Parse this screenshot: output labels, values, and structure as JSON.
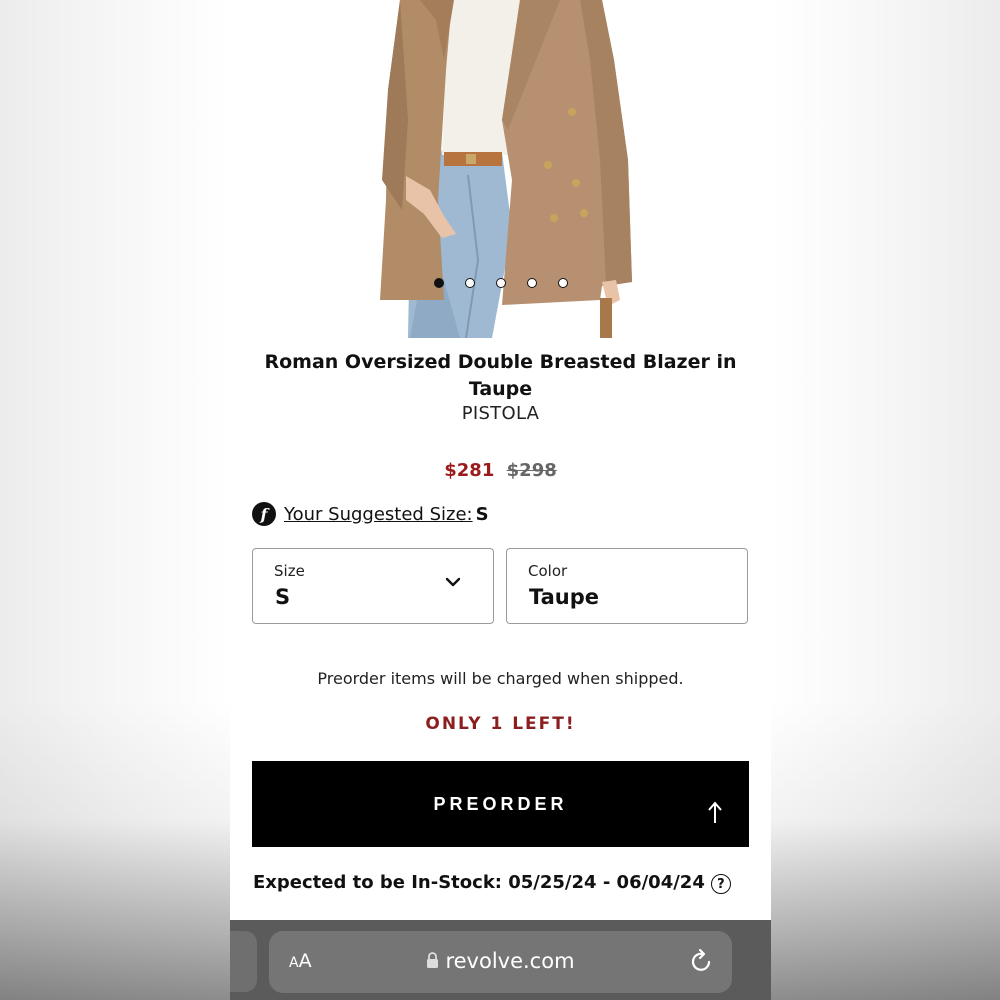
{
  "product": {
    "title": "Roman Oversized Double Breasted Blazer in Taupe",
    "brand": "PISTOLA",
    "sale_price": "$281",
    "original_price": "$298",
    "image_count": 5,
    "active_image_index": 0
  },
  "fit": {
    "link_text": "Your Suggested Size:",
    "suggested_size": "S",
    "logo_glyph": "f"
  },
  "size_select": {
    "label": "Size",
    "value": "S",
    "icon": "chevron-down-icon"
  },
  "color_select": {
    "label": "Color",
    "value": "Taupe"
  },
  "notes": {
    "preorder_note": "Preorder items will be charged when shipped.",
    "stock_left": "ONLY 1 LEFT!"
  },
  "cta": {
    "label": "PREORDER",
    "icon": "arrow-up-icon"
  },
  "in_stock": {
    "text": "Expected to be In-Stock: 05/25/24 - 06/04/24",
    "icon": "help-icon"
  },
  "browser": {
    "aa_large": "A",
    "aa_small": "A",
    "url": "revolve.com",
    "lock_icon": "lock-icon",
    "reload_icon": "reload-icon"
  },
  "colors": {
    "sale_red": "#9a1b1b",
    "stock_red": "#8b1f1f",
    "cta_black": "#000000",
    "blazer_taupe": "#b08a66"
  }
}
